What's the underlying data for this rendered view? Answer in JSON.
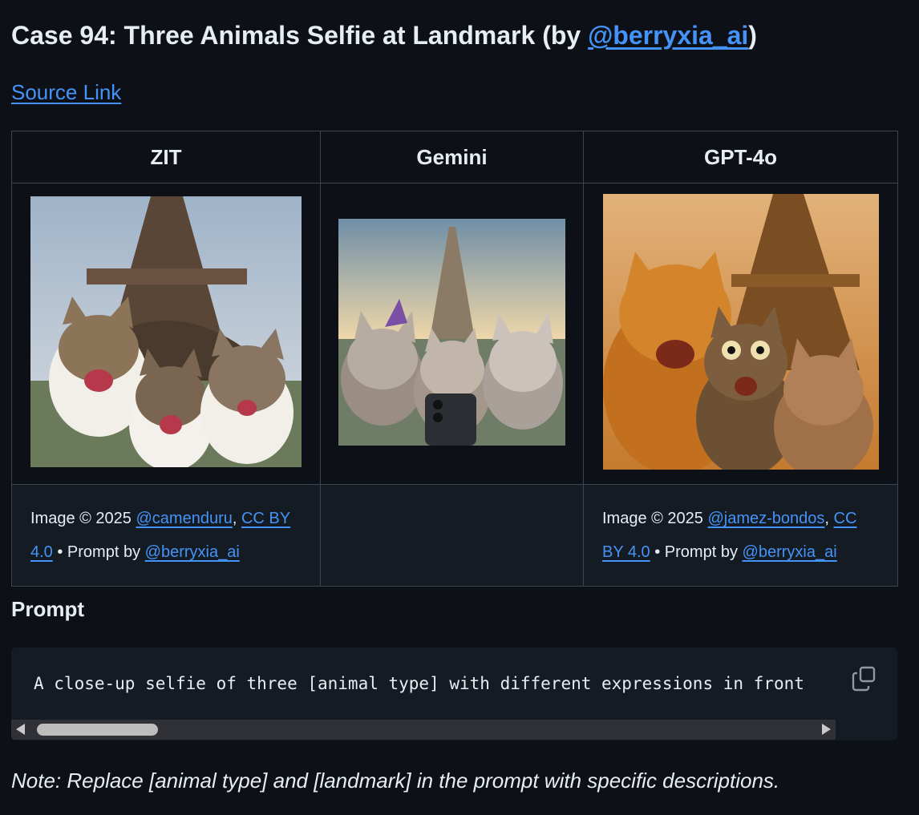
{
  "header": {
    "title_prefix": "Case 94: Three Animals Selfie at Landmark (by ",
    "title_author": "@berryxia_ai",
    "title_suffix": ")",
    "source_link": "Source Link"
  },
  "table": {
    "columns": [
      "ZIT",
      "Gemini",
      "GPT-4o"
    ],
    "images": [
      {
        "alt": "Three cats selfie in front of Eiffel Tower",
        "icon": "photo-icon"
      },
      {
        "alt": "Three cartoon kittens taking a selfie with phone at Eiffel Tower sunset",
        "icon": "photo-icon"
      },
      {
        "alt": "Three orange and tabby cats selfie at Eiffel Tower golden hour",
        "icon": "photo-icon"
      }
    ],
    "captions": [
      {
        "prefix": "Image © 2025 ",
        "author": "@camenduru",
        "sep": ", ",
        "license": "CC BY 4.0",
        "mid": " • Prompt by ",
        "prompt_author": "@berryxia_ai"
      },
      null,
      {
        "prefix": "Image © 2025 ",
        "author": "@jamez-bondos",
        "sep": ", ",
        "license": "CC BY 4.0",
        "mid": " • Prompt by ",
        "prompt_author": "@berryxia_ai"
      }
    ]
  },
  "prompt": {
    "heading": "Prompt",
    "code": "A close-up selfie of three [animal type] with different expressions in front",
    "copy_icon": "copy-icon"
  },
  "note": "Note: Replace [animal type] and [landmark] in the prompt with specific descriptions.",
  "colors": {
    "background": "#0d1117",
    "link": "#4493f8",
    "border": "#3d444d",
    "caption_bg": "#151b23"
  }
}
